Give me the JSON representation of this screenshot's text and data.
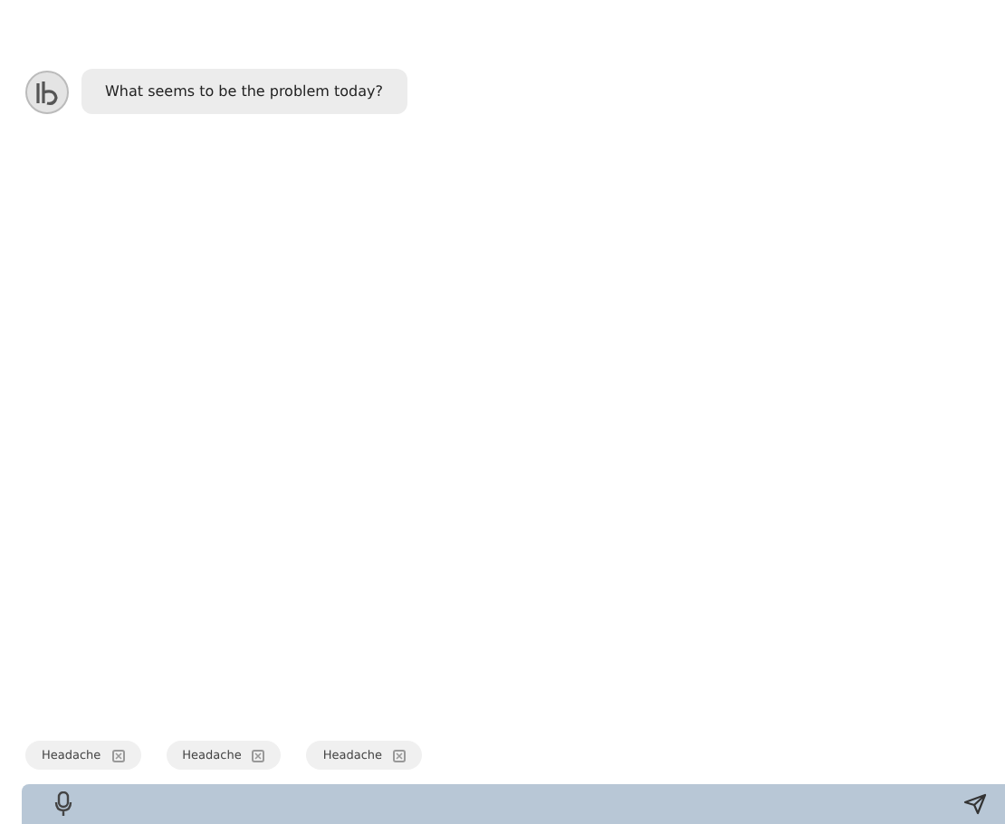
{
  "messages": [
    {
      "text": "What seems to be the problem today?"
    }
  ],
  "suggestions": [
    {
      "label": "Headache"
    },
    {
      "label": "Headache"
    },
    {
      "label": "Headache"
    }
  ]
}
